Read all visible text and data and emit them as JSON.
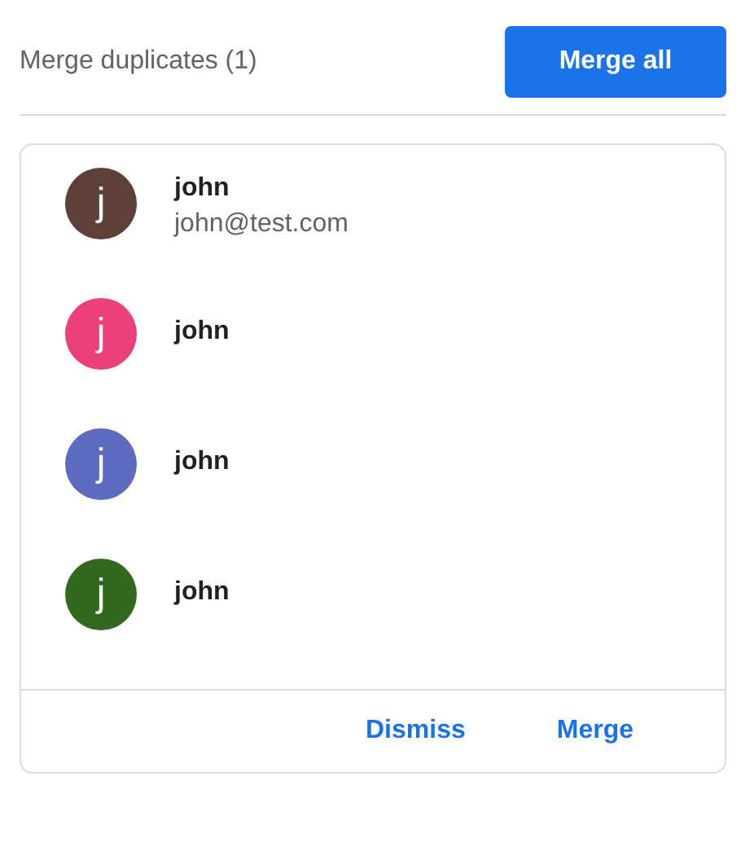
{
  "header": {
    "title": "Merge duplicates (1)",
    "button": "Merge all"
  },
  "contacts": [
    {
      "initial": "j",
      "color": "#5d4037",
      "name": "john",
      "email": "john@test.com"
    },
    {
      "initial": "j",
      "color": "#ec407a",
      "name": "john"
    },
    {
      "initial": "j",
      "color": "#5c6bc0",
      "name": "john"
    },
    {
      "initial": "j",
      "color": "#33691e",
      "name": "john"
    }
  ],
  "actions": [
    "Dismiss",
    "Merge"
  ]
}
